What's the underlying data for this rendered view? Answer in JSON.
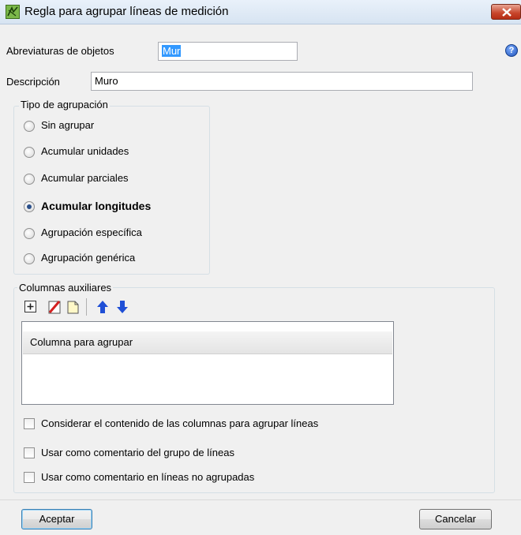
{
  "window": {
    "title": "Regla para agrupar líneas de medición"
  },
  "fields": {
    "abbrev_label": "Abreviaturas de objetos",
    "abbrev_value": "Mur",
    "desc_label": "Descripción",
    "desc_value": "Muro"
  },
  "grouping": {
    "title": "Tipo de agrupación",
    "options": [
      {
        "label": "Sin agrupar",
        "selected": false
      },
      {
        "label": "Acumular unidades",
        "selected": false
      },
      {
        "label": "Acumular parciales",
        "selected": false
      },
      {
        "label": "Acumular longitudes",
        "selected": true
      },
      {
        "label": "Agrupación específica",
        "selected": false
      },
      {
        "label": "Agrupación genérica",
        "selected": false
      }
    ]
  },
  "aux_columns": {
    "title": "Columnas auxiliares",
    "toolbar": {
      "icons": [
        "add-icon",
        "delete-icon",
        "copy-icon",
        "arrow-up-icon",
        "arrow-down-icon"
      ]
    },
    "list_rows": [
      "Columna para agrupar"
    ],
    "checkboxes": [
      {
        "label": "Considerar el contenido de las columnas para agrupar líneas",
        "checked": false
      },
      {
        "label": "Usar como comentario del grupo de líneas",
        "checked": false
      },
      {
        "label": "Usar como comentario en líneas no agrupadas",
        "checked": false
      }
    ]
  },
  "buttons": {
    "accept": "Aceptar",
    "cancel": "Cancelar"
  },
  "colors": {
    "selection": "#3399ff",
    "up_arrow": "#1f4fd6",
    "down_arrow": "#1f4fd6",
    "delete_red": "#d42020"
  }
}
